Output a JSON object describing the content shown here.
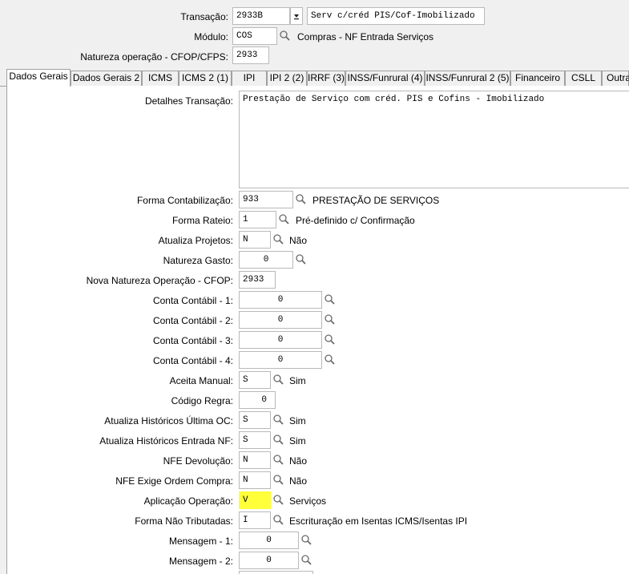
{
  "header": {
    "transacao_label": "Transação:",
    "transacao_code": "2933B",
    "transacao_desc": "Serv c/créd PIS/Cof-Imobilizado",
    "modulo_label": "Módulo:",
    "modulo_code": "COS",
    "modulo_desc": "Compras - NF Entrada Serviços",
    "natureza_label": "Natureza operação - CFOP/CFPS:",
    "natureza_value": "2933"
  },
  "tabs": [
    {
      "label": "Dados Gerais"
    },
    {
      "label": "Dados Gerais 2"
    },
    {
      "label": "ICMS"
    },
    {
      "label": "ICMS 2 (1)"
    },
    {
      "label": "IPI"
    },
    {
      "label": "IPI 2 (2)"
    },
    {
      "label": "IRRF (3)"
    },
    {
      "label": "INSS/Funrural (4)"
    },
    {
      "label": "INSS/Funrural 2 (5)"
    },
    {
      "label": "Financeiro"
    },
    {
      "label": "CSLL"
    },
    {
      "label": "Outra"
    }
  ],
  "form": {
    "detalhes_label": "Detalhes Transação:",
    "detalhes_value": "Prestação de Serviço com créd. PIS e Cofins - Imobilizado",
    "forma_contab_label": "Forma Contabilização:",
    "forma_contab_value": "933",
    "forma_contab_desc": "PRESTAÇÃO DE SERVIÇOS",
    "forma_rateio_label": "Forma Rateio:",
    "forma_rateio_value": "1",
    "forma_rateio_desc": "Pré-definido c/ Confirmação",
    "atualiza_projetos_label": "Atualiza Projetos:",
    "atualiza_projetos_value": "N",
    "atualiza_projetos_desc": "Não",
    "natureza_gasto_label": "Natureza Gasto:",
    "natureza_gasto_value": "0",
    "nova_natureza_label": "Nova Natureza Operação - CFOP:",
    "nova_natureza_value": "2933",
    "conta1_label": "Conta Contábil - 1:",
    "conta1_value": "0",
    "conta2_label": "Conta Contábil - 2:",
    "conta2_value": "0",
    "conta3_label": "Conta Contábil - 3:",
    "conta3_value": "0",
    "conta4_label": "Conta Contábil - 4:",
    "conta4_value": "0",
    "aceita_manual_label": "Aceita Manual:",
    "aceita_manual_value": "S",
    "aceita_manual_desc": "Sim",
    "codigo_regra_label": "Código Regra:",
    "codigo_regra_value": "0",
    "hist_oc_label": "Atualiza Históricos Última OC:",
    "hist_oc_value": "S",
    "hist_oc_desc": "Sim",
    "hist_nf_label": "Atualiza Históricos Entrada NF:",
    "hist_nf_value": "S",
    "hist_nf_desc": "Sim",
    "nfe_dev_label": "NFE Devolução:",
    "nfe_dev_value": "N",
    "nfe_dev_desc": "Não",
    "nfe_ordem_label": "NFE Exige Ordem Compra:",
    "nfe_ordem_value": "N",
    "nfe_ordem_desc": "Não",
    "aplicacao_label": "Aplicação Operação:",
    "aplicacao_value": "V",
    "aplicacao_desc": "Serviços",
    "forma_nao_trib_label": "Forma Não Tributadas:",
    "forma_nao_trib_value": "I",
    "forma_nao_trib_desc": "Escrituração em Isentas ICMS/Isentas IPI",
    "mensagem1_label": "Mensagem - 1:",
    "mensagem1_value": "0",
    "mensagem2_label": "Mensagem - 2:",
    "mensagem2_value": "0"
  },
  "colors": {
    "highlight": "#ffff3a",
    "panel": "#ffffff",
    "chrome": "#f0f0f0"
  }
}
